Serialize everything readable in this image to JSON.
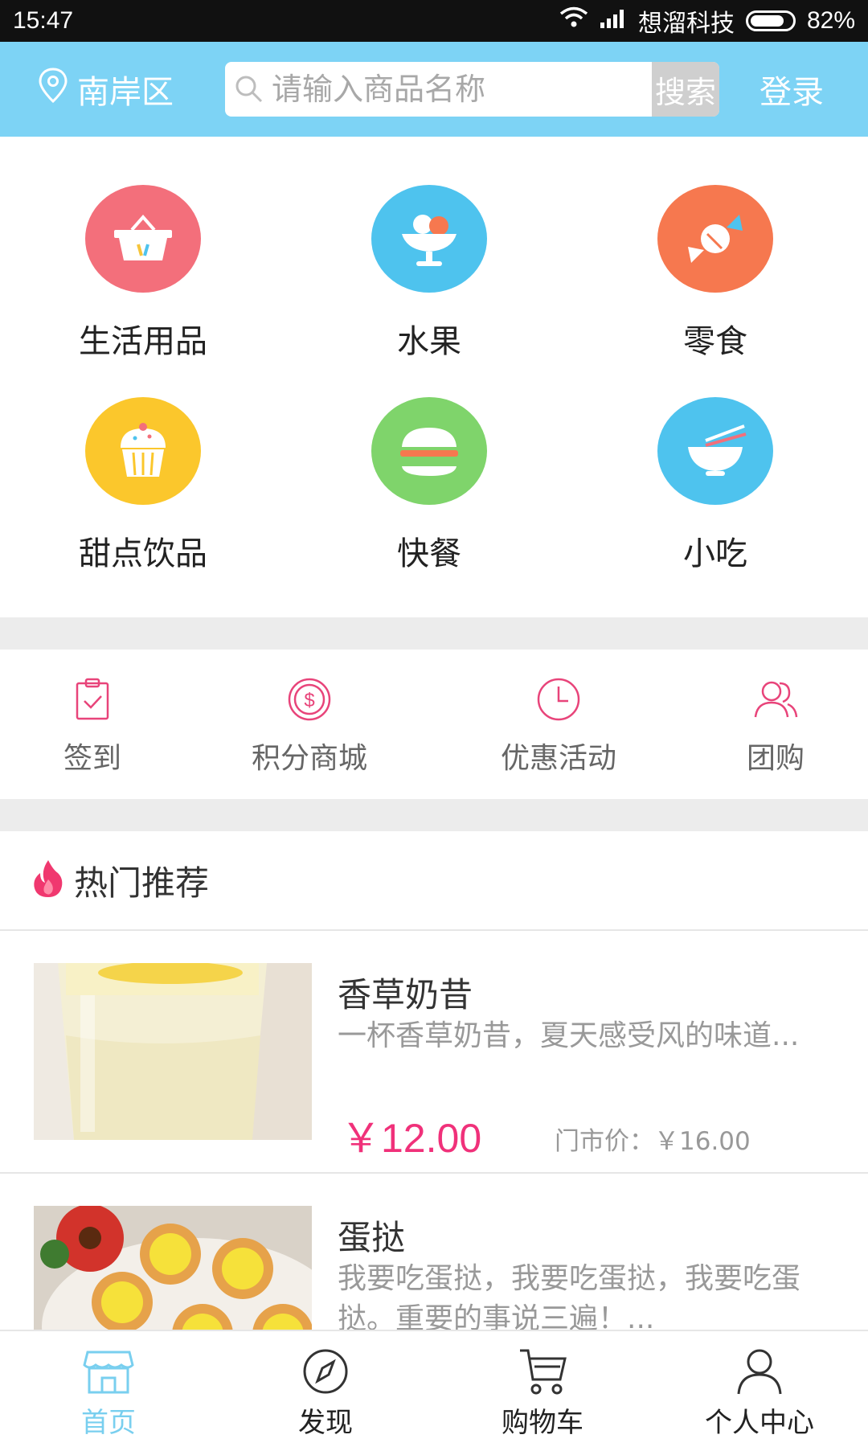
{
  "status_bar": {
    "time": "15:47",
    "carrier": "想溜科技",
    "battery_text": "82%",
    "battery_level": 0.82
  },
  "header": {
    "location": "南岸区",
    "search_placeholder": "请输入商品名称",
    "search_button": "搜索",
    "login": "登录"
  },
  "categories": [
    {
      "label": "生活用品",
      "icon": "basket-icon",
      "color": "#f36f7b"
    },
    {
      "label": "水果",
      "icon": "fruit-bowl-icon",
      "color": "#4ec3ee"
    },
    {
      "label": "零食",
      "icon": "candy-icon",
      "color": "#f6784f"
    },
    {
      "label": "甜点饮品",
      "icon": "cupcake-icon",
      "color": "#fbc72c"
    },
    {
      "label": "快餐",
      "icon": "burger-icon",
      "color": "#7fd46b"
    },
    {
      "label": "小吃",
      "icon": "noodle-bowl-icon",
      "color": "#4ec3ee"
    }
  ],
  "quick_nav": [
    {
      "label": "签到",
      "icon": "checkin-clipboard-icon"
    },
    {
      "label": "积分商城",
      "icon": "dollar-coin-icon"
    },
    {
      "label": "优惠活动",
      "icon": "clock-icon"
    },
    {
      "label": "团购",
      "icon": "group-users-icon"
    }
  ],
  "accent_color": "#e8447a",
  "hot": {
    "title": "热门推荐",
    "icon": "fire-icon",
    "products": [
      {
        "name": "香草奶昔",
        "description": "一杯香草奶昔，夏天感受风的味道...",
        "price": "￥12.00",
        "market_price": "门市价：￥16.00"
      },
      {
        "name": "蛋挞",
        "description": "我要吃蛋挞，我要吃蛋挞，我要吃蛋挞。重要的事说三遍！...",
        "price": "",
        "market_price": ""
      }
    ]
  },
  "tabbar": [
    {
      "label": "首页",
      "icon": "storefront-icon",
      "active": true
    },
    {
      "label": "发现",
      "icon": "compass-icon",
      "active": false
    },
    {
      "label": "购物车",
      "icon": "cart-icon",
      "active": false
    },
    {
      "label": "个人中心",
      "icon": "person-icon",
      "active": false
    }
  ]
}
